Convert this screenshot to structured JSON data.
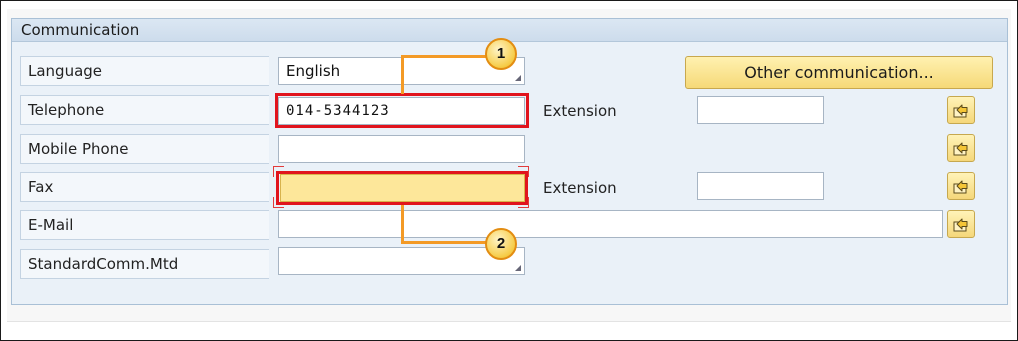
{
  "group": {
    "title": "Communication"
  },
  "rows": {
    "language": {
      "label": "Language",
      "value": "English"
    },
    "telephone": {
      "label": "Telephone",
      "value": "014-5344123",
      "extension_label": "Extension",
      "extension_value": ""
    },
    "mobile": {
      "label": "Mobile Phone",
      "value": ""
    },
    "fax": {
      "label": "Fax",
      "value": "",
      "extension_label": "Extension",
      "extension_value": ""
    },
    "email": {
      "label": "E-Mail",
      "value": ""
    },
    "standard": {
      "label": "StandardComm.Mtd",
      "value": ""
    }
  },
  "buttons": {
    "other_communication": "Other communication..."
  },
  "icons": {
    "more_entries": "arrow-into-box-icon"
  },
  "callouts": {
    "first": "1",
    "second": "2"
  },
  "colors": {
    "highlight": "#e1141d",
    "callout_line": "#f39a26",
    "yellow_field": "#fde79a"
  }
}
